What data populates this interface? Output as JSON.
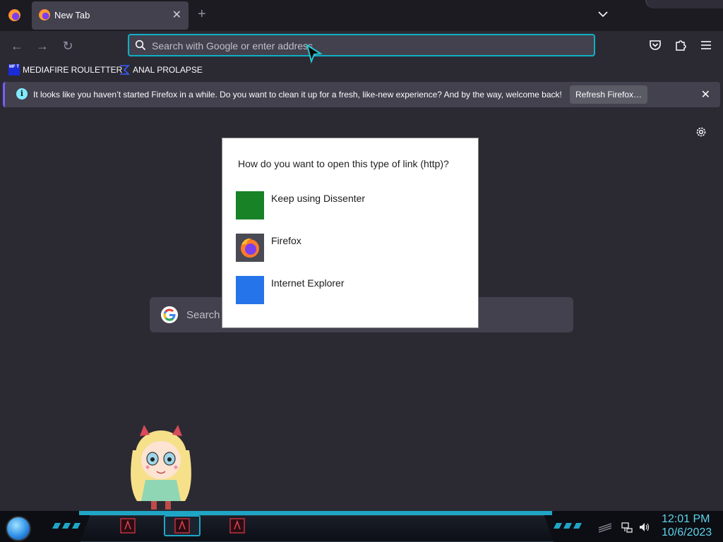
{
  "browser": {
    "tab": {
      "title": "New Tab"
    },
    "urlbar": {
      "placeholder": "Search with Google or enter address"
    },
    "bookmarks": [
      {
        "label": "MEDIAFIRE ROULETTER",
        "icon": "mediafire-icon",
        "icon_text": "MF T"
      },
      {
        "label": "ANAL PROLAPSE",
        "icon": "bookmark-sigma-icon"
      }
    ],
    "notification": {
      "message": "It looks like you haven’t started Firefox in a while. Do you want to clean it up for a fresh, like-new experience? And by the way, welcome back!",
      "button": "Refresh Firefox…"
    },
    "newtab": {
      "search_placeholder": "Search"
    }
  },
  "dialog": {
    "question": "How do you want to open this type of link (http)?",
    "options": [
      {
        "label": "Keep using Dissenter",
        "color": "#178226"
      },
      {
        "label": "Firefox",
        "icon": "firefox-icon"
      },
      {
        "label": "Internet Explorer",
        "color": "#2574ea"
      }
    ]
  },
  "taskbar": {
    "time": "12:01 PM",
    "date": "10/6/2023"
  },
  "colors": {
    "accent": "#0fb0c7",
    "taskbar_accent": "#1fa6c6",
    "clock": "#5fd3e8"
  }
}
